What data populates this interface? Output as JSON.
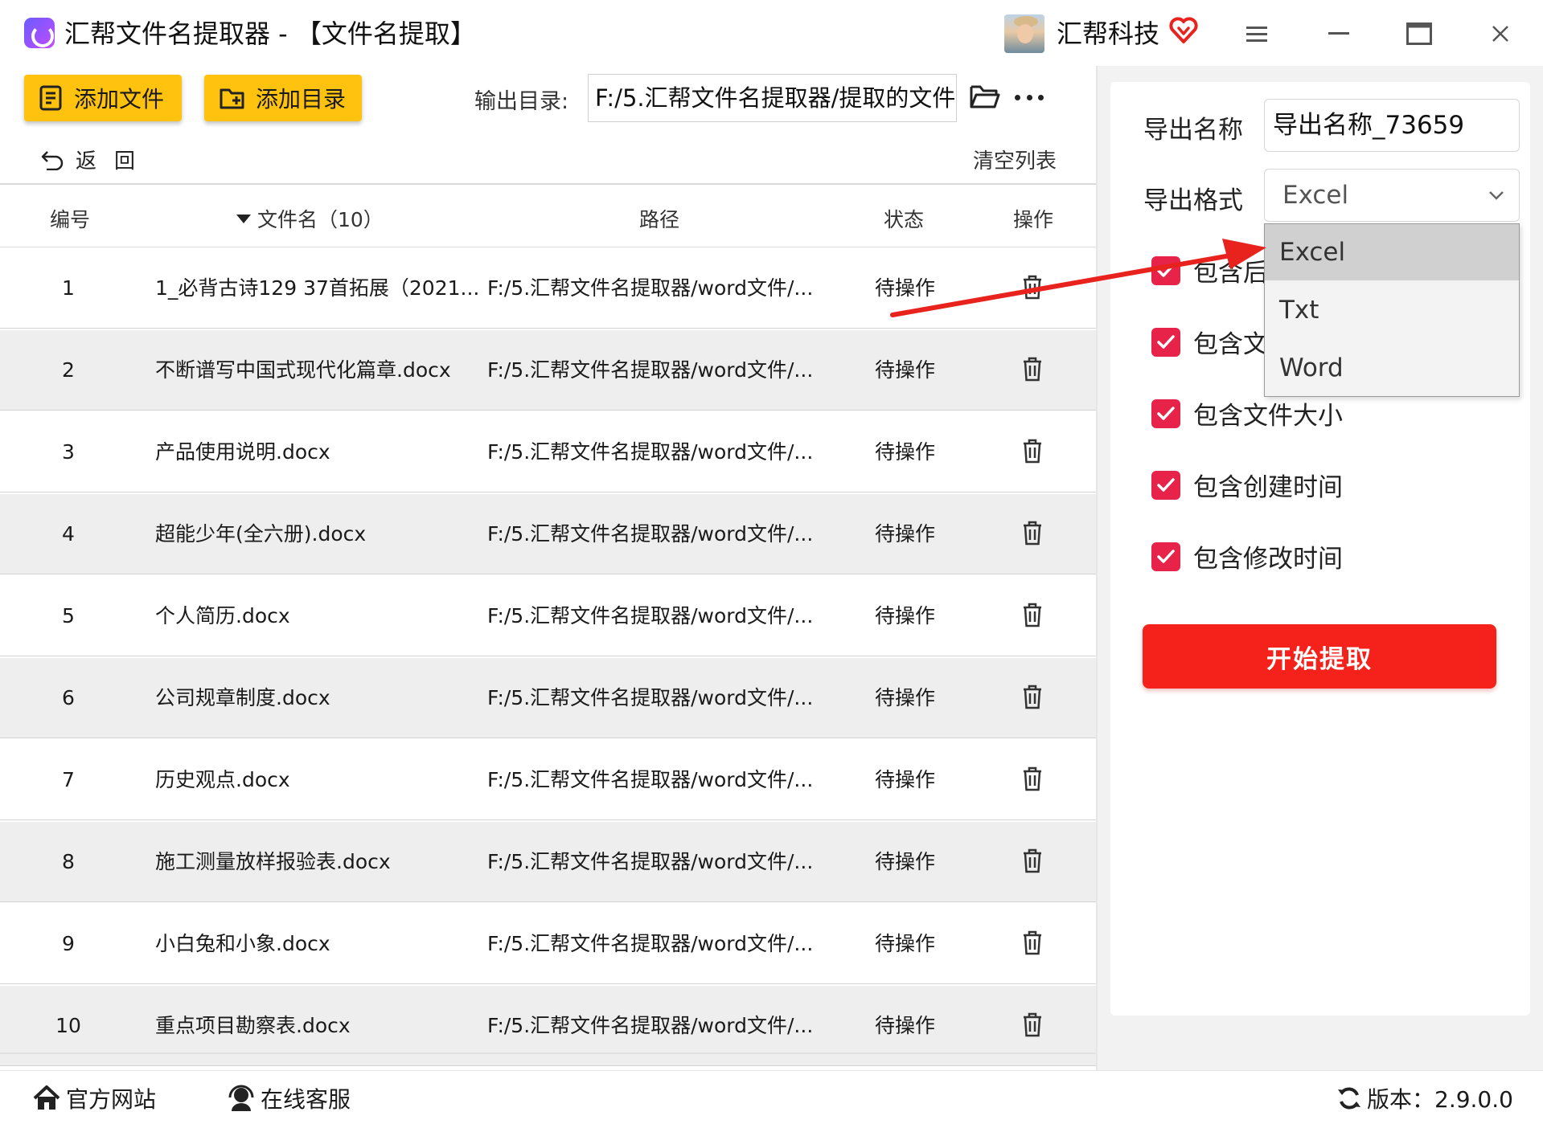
{
  "titlebar": {
    "app_title": "汇帮文件名提取器 - 【文件名提取】",
    "brand_name": "汇帮科技"
  },
  "toolbar": {
    "add_file_label": "添加文件",
    "add_dir_label": "添加目录",
    "output_dir_label": "输出目录:",
    "output_dir_value": "F:/5.汇帮文件名提取器/提取的文件"
  },
  "nav": {
    "back_label": "返回",
    "clear_label": "清空列表"
  },
  "table": {
    "headers": {
      "no": "编号",
      "name": "文件名（10）",
      "path": "路径",
      "status": "状态",
      "action": "操作"
    },
    "rows": [
      {
        "no": "1",
        "name": "1_必背古诗129 37首拓展（2021...",
        "path": "F:/5.汇帮文件名提取器/word文件/...",
        "status": "待操作"
      },
      {
        "no": "2",
        "name": "不断谱写中国式现代化篇章.docx",
        "path": "F:/5.汇帮文件名提取器/word文件/...",
        "status": "待操作"
      },
      {
        "no": "3",
        "name": "产品使用说明.docx",
        "path": "F:/5.汇帮文件名提取器/word文件/...",
        "status": "待操作"
      },
      {
        "no": "4",
        "name": "超能少年(全六册).docx",
        "path": "F:/5.汇帮文件名提取器/word文件/...",
        "status": "待操作"
      },
      {
        "no": "5",
        "name": "个人简历.docx",
        "path": "F:/5.汇帮文件名提取器/word文件/...",
        "status": "待操作"
      },
      {
        "no": "6",
        "name": "公司规章制度.docx",
        "path": "F:/5.汇帮文件名提取器/word文件/...",
        "status": "待操作"
      },
      {
        "no": "7",
        "name": "历史观点.docx",
        "path": "F:/5.汇帮文件名提取器/word文件/...",
        "status": "待操作"
      },
      {
        "no": "8",
        "name": "施工测量放样报验表.docx",
        "path": "F:/5.汇帮文件名提取器/word文件/...",
        "status": "待操作"
      },
      {
        "no": "9",
        "name": "小白兔和小象.docx",
        "path": "F:/5.汇帮文件名提取器/word文件/...",
        "status": "待操作"
      },
      {
        "no": "10",
        "name": "重点项目勘察表.docx",
        "path": "F:/5.汇帮文件名提取器/word文件/...",
        "status": "待操作"
      }
    ]
  },
  "settings": {
    "export_name_label": "导出名称",
    "export_name_value": "导出名称_73659",
    "export_format_label": "导出格式",
    "export_format_value": "Excel",
    "format_options": [
      "Excel",
      "Txt",
      "Word"
    ],
    "checkboxes": [
      {
        "label": "包含后",
        "checked": true
      },
      {
        "label": "包含文",
        "checked": true
      },
      {
        "label": "包含文件大小",
        "checked": true
      },
      {
        "label": "包含创建时间",
        "checked": true
      },
      {
        "label": "包含修改时间",
        "checked": true
      }
    ],
    "start_label": "开始提取"
  },
  "footer": {
    "website_label": "官方网站",
    "service_label": "在线客服",
    "version_label": "版本：2.9.0.0"
  },
  "colors": {
    "accent_yellow": "#ffc20e",
    "start_red": "#f5221b",
    "checkbox_red": "#e8234a",
    "arrow_red": "#e8231e"
  }
}
